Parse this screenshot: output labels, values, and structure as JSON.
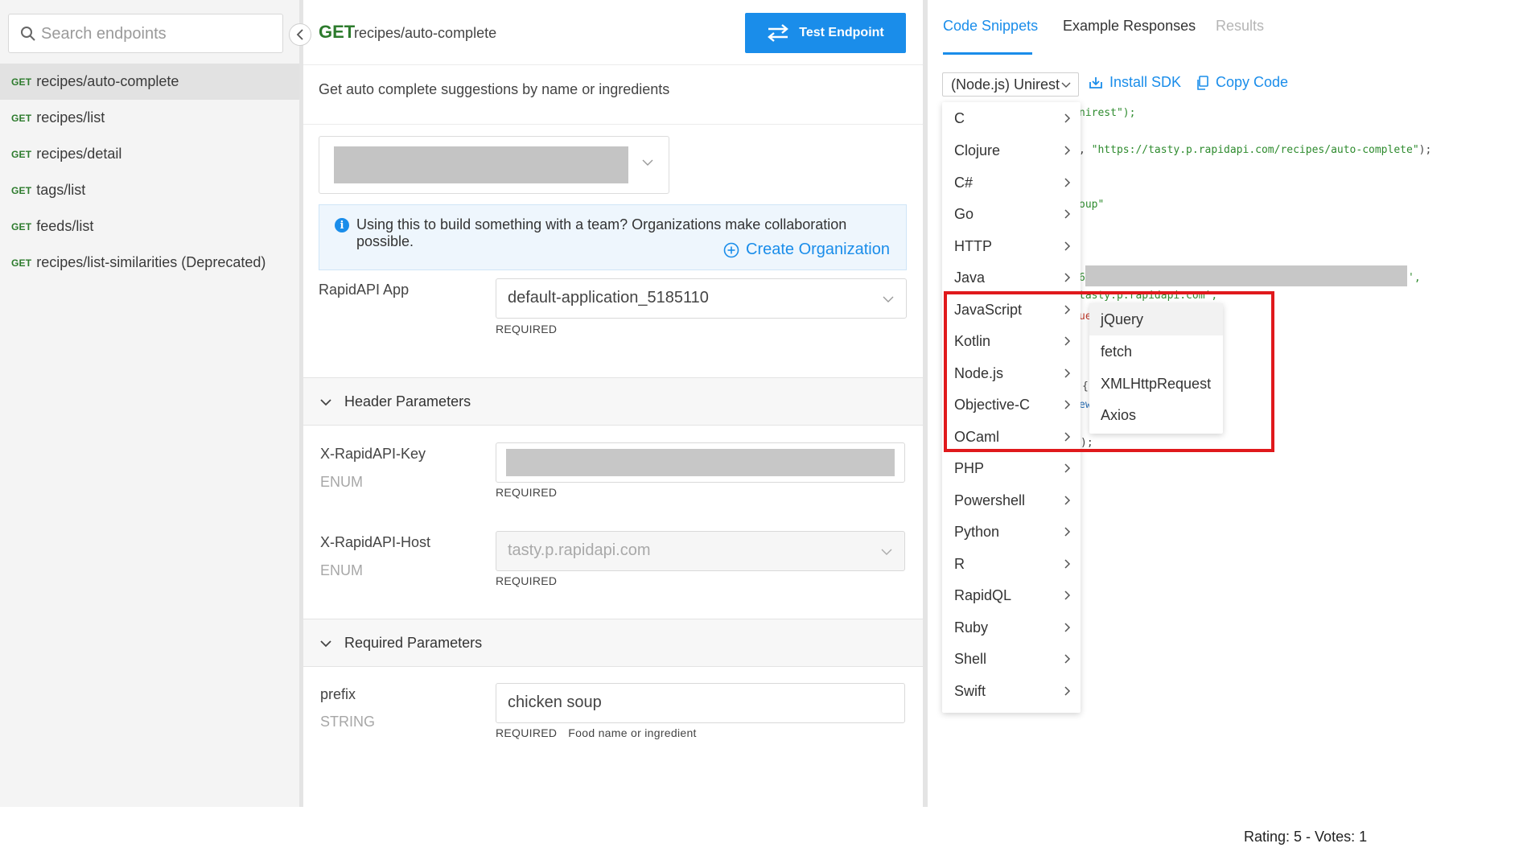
{
  "sidebar": {
    "search_placeholder": "Search endpoints",
    "endpoints": [
      {
        "method": "GET",
        "label": "recipes/auto-complete",
        "active": true
      },
      {
        "method": "GET",
        "label": "recipes/list"
      },
      {
        "method": "GET",
        "label": "recipes/detail"
      },
      {
        "method": "GET",
        "label": "tags/list"
      },
      {
        "method": "GET",
        "label": "feeds/list"
      },
      {
        "method": "GET",
        "label": "recipes/list-similarities (Deprecated)"
      }
    ]
  },
  "endpoint": {
    "method": "GET",
    "path": "recipes/auto-complete",
    "test_button": "Test Endpoint",
    "description": "Get auto complete suggestions by name or ingredients"
  },
  "info_banner": {
    "text": "Using this to build something with a team? Organizations make collaboration possible.",
    "link": "Create Organization"
  },
  "app_field": {
    "label": "RapidAPI App",
    "value": "default-application_5185110",
    "required": "REQUIRED"
  },
  "header_params": {
    "title": "Header Parameters",
    "key": {
      "label": "X-RapidAPI-Key",
      "type": "ENUM",
      "required": "REQUIRED"
    },
    "host": {
      "label": "X-RapidAPI-Host",
      "type": "ENUM",
      "value": "tasty.p.rapidapi.com",
      "required": "REQUIRED"
    }
  },
  "required_params": {
    "title": "Required Parameters",
    "prefix": {
      "label": "prefix",
      "type": "STRING",
      "value": "chicken soup",
      "required": "REQUIRED",
      "hint": "Food name or ingredient"
    }
  },
  "right_tabs": {
    "code": "Code Snippets",
    "examples": "Example Responses",
    "results": "Results"
  },
  "toolbar": {
    "language_selected": "(Node.js) Unirest",
    "install_sdk": "Install SDK",
    "copy_code": "Copy Code"
  },
  "code_fragments": {
    "line1": "nirest\");",
    "line2_a": ", ",
    "line2_b": "\"https://tasty.p.rapidapi.com/recipes/auto-complete\"",
    "line2_c": ");",
    "line3": "oup\"",
    "line4_a": "6",
    "line4_b": "',",
    "line5": "tasty.p.rapidapi.com',",
    "line6": "ue",
    "line7": "{",
    "line8": "ew",
    "line9": ");"
  },
  "language_menu": [
    "C",
    "Clojure",
    "C#",
    "Go",
    "HTTP",
    "Java",
    "JavaScript",
    "Kotlin",
    "Node.js",
    "Objective-C",
    "OCaml",
    "PHP",
    "Powershell",
    "Python",
    "R",
    "RapidQL",
    "Ruby",
    "Shell",
    "Swift"
  ],
  "javascript_submenu": [
    "jQuery",
    "fetch",
    "XMLHttpRequest",
    "Axios"
  ],
  "footer": {
    "rating": "Rating: 5 - Votes: 1"
  },
  "colors": {
    "accent": "#1a8dea",
    "get_method": "#2d7b2d",
    "highlight": "#e0191c"
  }
}
